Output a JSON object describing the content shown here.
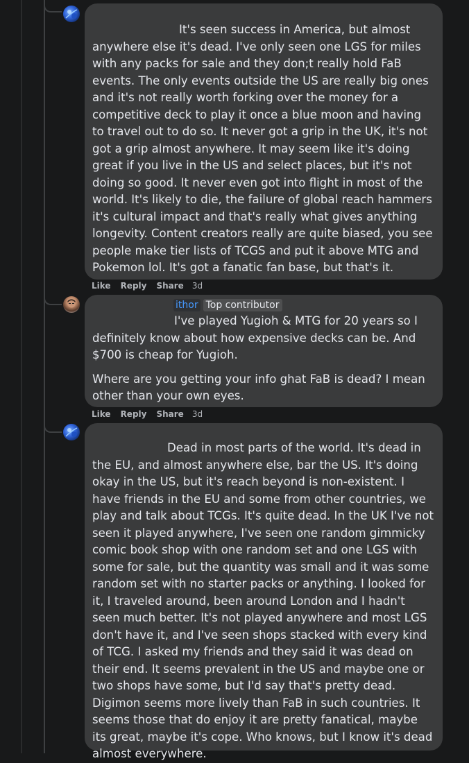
{
  "comments": [
    {
      "avatar": "blue-abstract-avatar",
      "text": "It's seen success in America, but almost anywhere else it's dead. I've only seen one LGS for miles with any packs for sale and they don;t really hold FaB events. The only events outside the US are really big ones and it's not really worth forking over the money for a competitive deck to play it once a blue moon and having to travel out to do so. It never got a grip in the UK, it's not got a grip almost anywhere. It may seem like it's doing great if you live in the US and select places, but it's not doing so good. It never even got into flight in most of the world. It's likely to die, the failure of global reach hammers it's cultural impact and that's really what gives anything longevity. Content creators really are quite biased, you see people make tier lists of TCGS and put it above MTG and Pokemon lol. It's got a fanatic fan base, but that's it.",
      "actions": {
        "like": "Like",
        "reply": "Reply",
        "share": "Share",
        "time": "3d"
      }
    },
    {
      "avatar": "person-photo-avatar",
      "author_fragment": "ithor",
      "badge": "Top contributor",
      "text1": "I've played Yugioh & MTG for 20 years so I definitely know about how expensive decks can be. And $700 is cheap for Yugioh.",
      "text2": "Where are you getting your info ghat FaB is dead? I mean other than your own eyes.",
      "actions": {
        "like": "Like",
        "reply": "Reply",
        "share": "Share",
        "time": "3d"
      }
    },
    {
      "avatar": "blue-abstract-avatar",
      "text": "Dead in most parts of the world. It's dead in the EU, and almost anywhere else, bar the US. It's doing okay in the US, but it's reach beyond is non-existent. I have friends in the EU and some from other countries, we play and talk about TCGs. It's quite dead. In the UK I've not seen it played anywhere, I've seen one random gimmicky comic book shop with one random set and one LGS with some for sale, but the quantity was small and it was some random set with no starter packs or anything. I looked for it, I traveled around, been around London and I hadn't seen much better. It's not played anywhere and most LGS don't have it, and I've seen shops stacked with every kind of TCG. I asked my friends and they said it was dead on their end. It seems prevalent in the US and maybe one or two shops have some, but I'd say that's pretty dead. Digimon seems more lively than FaB in such countries. It seems those that do enjoy it are pretty fanatical, maybe its great, maybe it's cope. Who knows, but I know it's dead almost everywhere."
    }
  ]
}
